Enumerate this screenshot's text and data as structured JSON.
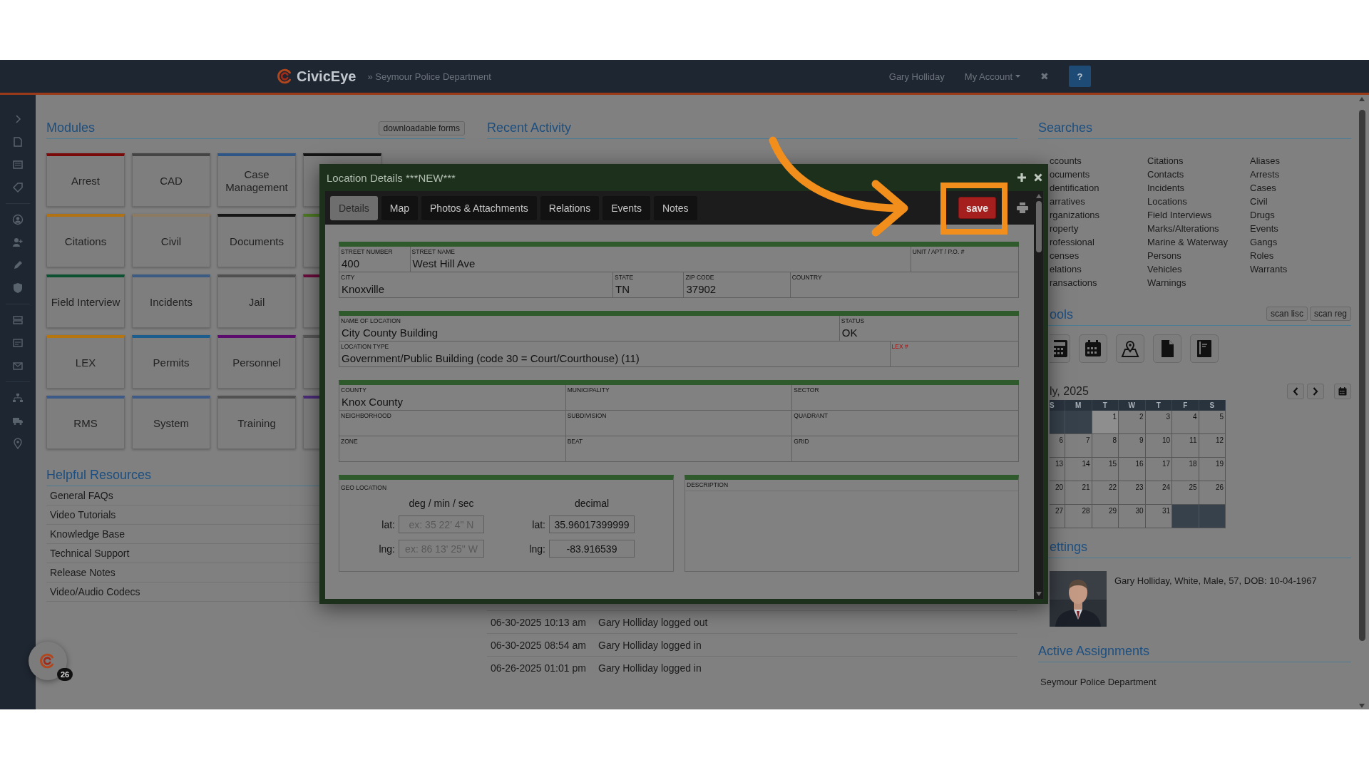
{
  "header": {
    "logo": "CivicEye",
    "breadcrumb": "» Seymour Police Department",
    "user": "Gary Holliday",
    "account_menu": "My Account",
    "close": "✖",
    "help": "?"
  },
  "modules": {
    "title": "Modules",
    "forms_button": "downloadable forms",
    "tiles": [
      {
        "label": "Arrest",
        "color": "#7a0a0a"
      },
      {
        "label": "CAD",
        "color": "#444444"
      },
      {
        "label": "Case Management",
        "color": "#2d5585"
      },
      {
        "color": "#141414"
      },
      {
        "label": "Citations",
        "color": "#b07212"
      },
      {
        "label": "Civil",
        "color": "#8c7b62"
      },
      {
        "label": "Documents",
        "color": "#161616"
      },
      {
        "color": "#4d7a22"
      },
      {
        "label": "Field Interview",
        "color": "#0c5232"
      },
      {
        "label": "Incidents",
        "color": "#3c5b82"
      },
      {
        "label": "Jail",
        "color": "#505050"
      },
      {
        "color": "#6a0c3c"
      },
      {
        "label": "LEX",
        "color": "#b5760f"
      },
      {
        "label": "Permits",
        "color": "#1b5d8c"
      },
      {
        "label": "Personnel",
        "color": "#5c0c6c"
      },
      {
        "color": "#575757"
      },
      {
        "label": "RMS",
        "color": "#3b5a88"
      },
      {
        "label": "System",
        "color": "#3d5b86"
      },
      {
        "label": "Training",
        "color": "#525252"
      },
      {
        "color": "#4b2c7a"
      }
    ]
  },
  "helpful_resources": {
    "title": "Helpful Resources",
    "links": [
      "General FAQs",
      "Video Tutorials",
      "Knowledge Base",
      "Technical Support",
      "Release Notes",
      "Video/Audio Codecs"
    ]
  },
  "recent_activity": {
    "title": "Recent Activity",
    "entries": [
      {
        "time": "06-30-2025 10:13 am",
        "text": "Gary Holliday logged out"
      },
      {
        "time": "06-30-2025 08:54 am",
        "text": "Gary Holliday logged in"
      },
      {
        "time": "06-26-2025 01:01 pm",
        "text": "Gary Holliday logged in"
      }
    ]
  },
  "searches": {
    "title": "Searches",
    "columns": [
      [
        "ccounts",
        "ocuments",
        "dentification",
        "arratives",
        "rganizations",
        "roperty",
        "rofessional",
        "censes",
        "elations",
        "ransactions"
      ],
      [
        "Citations",
        "Contacts",
        "Incidents",
        "Locations",
        "Field Interviews",
        "Marks/Alterations",
        "Marine & Waterway",
        "Persons",
        "Vehicles",
        "Warnings"
      ],
      [
        "Aliases",
        "Arrests",
        "Cases",
        "Civil",
        "Drugs",
        "Events",
        "Gangs",
        "Roles",
        "Warrants"
      ]
    ]
  },
  "tools": {
    "title": "ools",
    "buttons": [
      "scan lisc",
      "scan reg"
    ]
  },
  "calendar": {
    "month": "ly, 2025",
    "weekdays": [
      "S",
      "M",
      "T",
      "W",
      "T",
      "F",
      "S"
    ],
    "weeks": [
      [
        {
          "kind": "blank"
        },
        {
          "kind": "blank"
        },
        {
          "kind": "day",
          "day": "1",
          "today": true
        },
        {
          "kind": "day",
          "day": "2",
          "today": false
        },
        {
          "kind": "day",
          "day": "3",
          "today": false
        },
        {
          "kind": "day",
          "day": "4",
          "today": false
        },
        {
          "kind": "day",
          "day": "5",
          "today": false
        }
      ],
      [
        {
          "kind": "day",
          "day": "6",
          "today": false
        },
        {
          "kind": "day",
          "day": "7",
          "today": false
        },
        {
          "kind": "day",
          "day": "8",
          "today": false
        },
        {
          "kind": "day",
          "day": "9",
          "today": false
        },
        {
          "kind": "day",
          "day": "10",
          "today": false
        },
        {
          "kind": "day",
          "day": "11",
          "today": false
        },
        {
          "kind": "day",
          "day": "12",
          "today": false
        }
      ],
      [
        {
          "kind": "day",
          "day": "13",
          "today": false
        },
        {
          "kind": "day",
          "day": "14",
          "today": false
        },
        {
          "kind": "day",
          "day": "15",
          "today": false
        },
        {
          "kind": "day",
          "day": "16",
          "today": false
        },
        {
          "kind": "day",
          "day": "17",
          "today": false
        },
        {
          "kind": "day",
          "day": "18",
          "today": false
        },
        {
          "kind": "day",
          "day": "19",
          "today": false
        }
      ],
      [
        {
          "kind": "day",
          "day": "20",
          "today": false
        },
        {
          "kind": "day",
          "day": "21",
          "today": false
        },
        {
          "kind": "day",
          "day": "22",
          "today": false
        },
        {
          "kind": "day",
          "day": "23",
          "today": false
        },
        {
          "kind": "day",
          "day": "24",
          "today": false
        },
        {
          "kind": "day",
          "day": "25",
          "today": false
        },
        {
          "kind": "day",
          "day": "26",
          "today": false
        }
      ],
      [
        {
          "kind": "day",
          "day": "27",
          "today": false
        },
        {
          "kind": "day",
          "day": "28",
          "today": false
        },
        {
          "kind": "day",
          "day": "29",
          "today": false
        },
        {
          "kind": "day",
          "day": "30",
          "today": false
        },
        {
          "kind": "day",
          "day": "31",
          "today": false
        },
        {
          "kind": "blank"
        },
        {
          "kind": "blank"
        }
      ]
    ]
  },
  "settings": {
    "title": "ettings",
    "profile": "Gary Holliday, White, Male, 57, DOB: 10-04-1967"
  },
  "active_assignments": {
    "title": "Active Assignments",
    "items": [
      "Seymour Police Department"
    ]
  },
  "notifications": {
    "count": "26"
  },
  "modal": {
    "title": "Location Details ***NEW***",
    "tabs": [
      {
        "label": "Details",
        "selected": true
      },
      {
        "label": "Map",
        "selected": false
      },
      {
        "label": "Photos & Attachments",
        "selected": false
      },
      {
        "label": "Relations",
        "selected": false
      },
      {
        "label": "Events",
        "selected": false
      },
      {
        "label": "Notes",
        "selected": false
      }
    ],
    "save": "save",
    "sections": [
      {
        "rows": [
          [
            {
              "label": "STREET NUMBER",
              "value": "400",
              "required": false
            },
            {
              "label": "STREET NAME",
              "value": "West Hill Ave",
              "required": false
            },
            {
              "label": "UNIT / APT / P.O. #",
              "required": false
            }
          ],
          [
            {
              "label": "CITY",
              "value": "Knoxville",
              "required": false
            },
            {
              "label": "STATE",
              "value": "TN",
              "required": false
            },
            {
              "label": "ZIP CODE",
              "value": "37902",
              "required": false
            },
            {
              "label": "COUNTRY",
              "required": false
            }
          ]
        ]
      },
      {
        "rows": [
          [
            {
              "label": "NAME OF LOCATION",
              "value": "City County Building",
              "required": false
            },
            {
              "label": "STATUS",
              "value": "OK",
              "required": false
            }
          ],
          [
            {
              "label": "LOCATION TYPE",
              "value": "Government/Public Building (code 30 = Court/Courthouse) (11)",
              "required": false
            },
            {
              "label": "LEX #",
              "required": true
            }
          ]
        ]
      },
      {
        "rows": [
          [
            {
              "label": "COUNTY",
              "value": "Knox County",
              "required": false
            },
            {
              "label": "MUNICIPALITY",
              "required": false
            },
            {
              "label": "SECTOR",
              "required": false
            }
          ],
          [
            {
              "label": "NEIGHBORHOOD",
              "required": false
            },
            {
              "label": "SUBDIVISION",
              "required": false
            },
            {
              "label": "QUADRANT",
              "required": false
            }
          ],
          [
            {
              "label": "ZONE",
              "required": false
            },
            {
              "label": "BEAT",
              "required": false
            },
            {
              "label": "GRID",
              "required": false
            }
          ]
        ]
      }
    ],
    "geo": {
      "label": "GEO LOCATION",
      "dms_heading": "deg / min / sec",
      "decimal_heading": "decimal",
      "rows": [
        {
          "label": "lat:",
          "placeholder": "ex: 35 22' 4\" N",
          "decimal_label": "lat:",
          "decimal_value": "35.96017399999"
        },
        {
          "label": "lng:",
          "placeholder": "ex: 86 13' 25\" W",
          "decimal_label": "lng:",
          "decimal_value": "-83.916539"
        }
      ]
    },
    "description": {
      "label": "DESCRIPTION"
    }
  }
}
